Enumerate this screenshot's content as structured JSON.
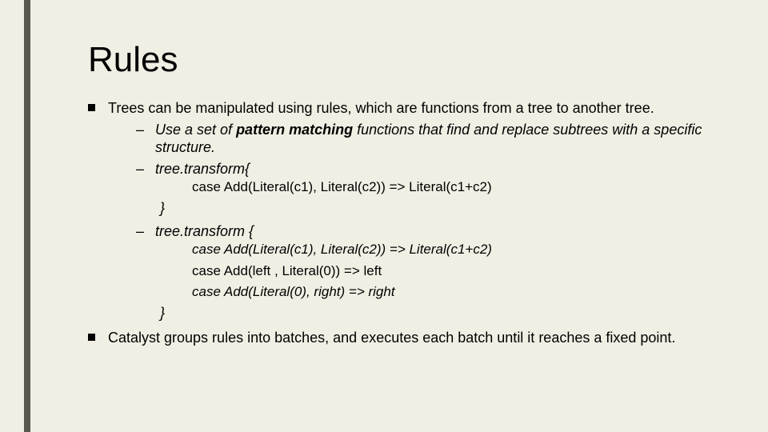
{
  "title": "Rules",
  "bullet1": {
    "text": "Trees can be manipulated using rules, which are functions from a tree to another tree."
  },
  "sub1": {
    "prefix": "Use a set of ",
    "bold": "pattern matching",
    "suffix": " functions that find and replace subtrees with a specific structure."
  },
  "sub2": {
    "text": "tree.transform{"
  },
  "code1": "case Add(Literal(c1), Literal(c2)) => Literal(c1+c2)",
  "close1": "}",
  "sub3": {
    "text": "tree.transform {"
  },
  "code2a": "case Add(Literal(c1), Literal(c2)) => Literal(c1+c2)",
  "code2b": "case Add(left , Literal(0)) => left",
  "code2c": "case Add(Literal(0), right) => right",
  "close2": "}",
  "bullet2": {
    "text": "Catalyst groups rules into batches, and executes each batch until it reaches a fixed point."
  }
}
